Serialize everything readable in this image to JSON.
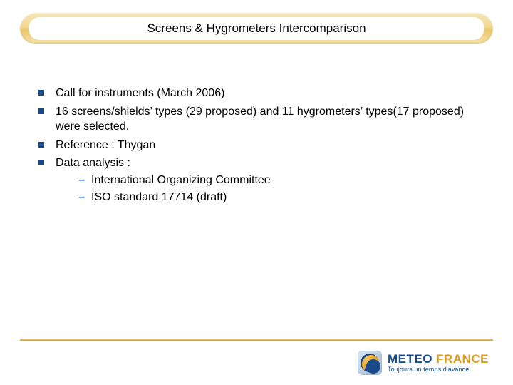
{
  "title": "Screens & Hygrometers Intercomparison",
  "bullets": [
    {
      "text": "Call for instruments (March 2006)"
    },
    {
      "text": "16 screens/shields’ types (29 proposed) and 11 hygrometers’ types(17 proposed) were selected."
    },
    {
      "text": "Reference : Thygan"
    },
    {
      "text": "Data analysis :",
      "sub": [
        "International Organizing Committee",
        "ISO standard 17714 (draft)"
      ]
    }
  ],
  "footer": {
    "brand_prefix": "METEO",
    "brand_suffix": "FRANCE",
    "tagline": "Toujours un temps d'avance"
  }
}
